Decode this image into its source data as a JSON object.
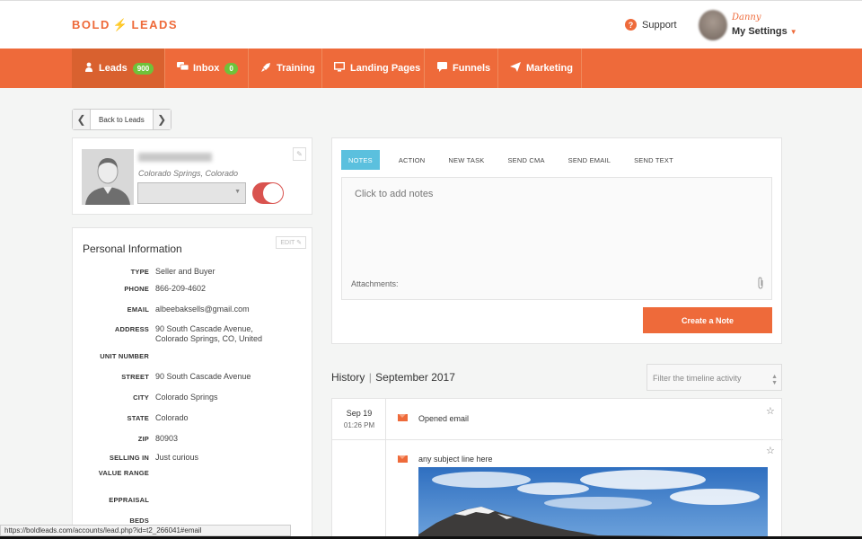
{
  "brand": {
    "logo_left": "BOLD",
    "logo_bolt": "⚡",
    "logo_right": "LEADS",
    "accent": "#ee6a3a"
  },
  "header": {
    "support_label": "Support",
    "user_name": "Danny",
    "settings_label": "My Settings"
  },
  "nav": {
    "items": [
      {
        "label": "Leads",
        "badge": "900",
        "icon": "person-icon"
      },
      {
        "label": "Inbox",
        "badge": "0",
        "icon": "chat-icon"
      },
      {
        "label": "Training",
        "icon": "rocket-icon"
      },
      {
        "label": "Landing Pages",
        "icon": "monitor-icon"
      },
      {
        "label": "Funnels",
        "icon": "comment-icon"
      },
      {
        "label": "Marketing",
        "icon": "send-icon"
      }
    ]
  },
  "back": {
    "label": "Back to Leads",
    "prev": "❮",
    "next": "❯"
  },
  "profile": {
    "location": "Colorado Springs, Colorado"
  },
  "personal": {
    "title": "Personal Information",
    "edit_label": "EDIT",
    "fields": [
      {
        "key": "TYPE",
        "value": "Seller and Buyer"
      },
      {
        "key": "PHONE",
        "value": "866-209-4602"
      },
      {
        "key": "EMAIL",
        "value": "albeebaksells@gmail.com"
      },
      {
        "key": "ADDRESS",
        "value": "90 South Cascade Avenue,",
        "value2": "Colorado Springs, CO, United"
      },
      {
        "key": "UNIT NUMBER",
        "value": ""
      },
      {
        "key": "STREET",
        "value": "90 South Cascade Avenue"
      },
      {
        "key": "CITY",
        "value": "Colorado Springs"
      },
      {
        "key": "STATE",
        "value": "Colorado"
      },
      {
        "key": "ZIP",
        "value": "80903"
      },
      {
        "key": "SELLING IN",
        "value": "Just curious"
      },
      {
        "key": "VALUE RANGE",
        "value": ""
      },
      {
        "key": "EPPRAISAL",
        "value": ""
      },
      {
        "key": "BEDS",
        "value": ""
      }
    ]
  },
  "notes": {
    "tabs": [
      "NOTES",
      "ACTION",
      "NEW TASK",
      "SEND CMA",
      "SEND EMAIL",
      "SEND TEXT"
    ],
    "placeholder": "Click to add notes",
    "attachments_label": "Attachments:",
    "create_label": "Create a Note"
  },
  "history": {
    "title_left": "History",
    "title_right": "September 2017",
    "filter_placeholder": "Filter the timeline activity",
    "entries": [
      {
        "date": "Sep 19",
        "time": "01:26 PM",
        "text": "Opened email"
      },
      {
        "text": "any subject line here"
      }
    ]
  },
  "statusbar": {
    "url": "https://boldleads.com/accounts/lead.php?id=t2_266041#email"
  }
}
